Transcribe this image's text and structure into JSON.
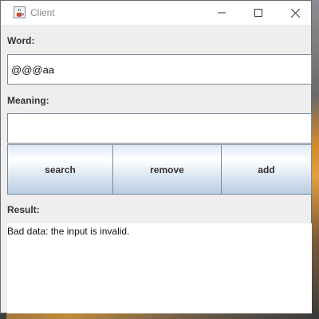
{
  "window": {
    "title": "Client",
    "icon": "java-cup-icon",
    "controls": {
      "minimize_icon": "minimize-icon",
      "maximize_icon": "maximize-icon",
      "close_icon": "close-icon"
    }
  },
  "form": {
    "word_label": "Word:",
    "word_value": "@@@aa",
    "meaning_label": "Meaning:",
    "meaning_value": ""
  },
  "buttons": {
    "search_label": "search",
    "remove_label": "remove",
    "add_label": "add"
  },
  "result": {
    "label": "Result:",
    "text": "Bad data: the input is invalid."
  },
  "colors": {
    "window_bg": "#eeeeee",
    "field_border": "#7a8a9a",
    "button_gradient_bottom": "#b9cde0"
  }
}
